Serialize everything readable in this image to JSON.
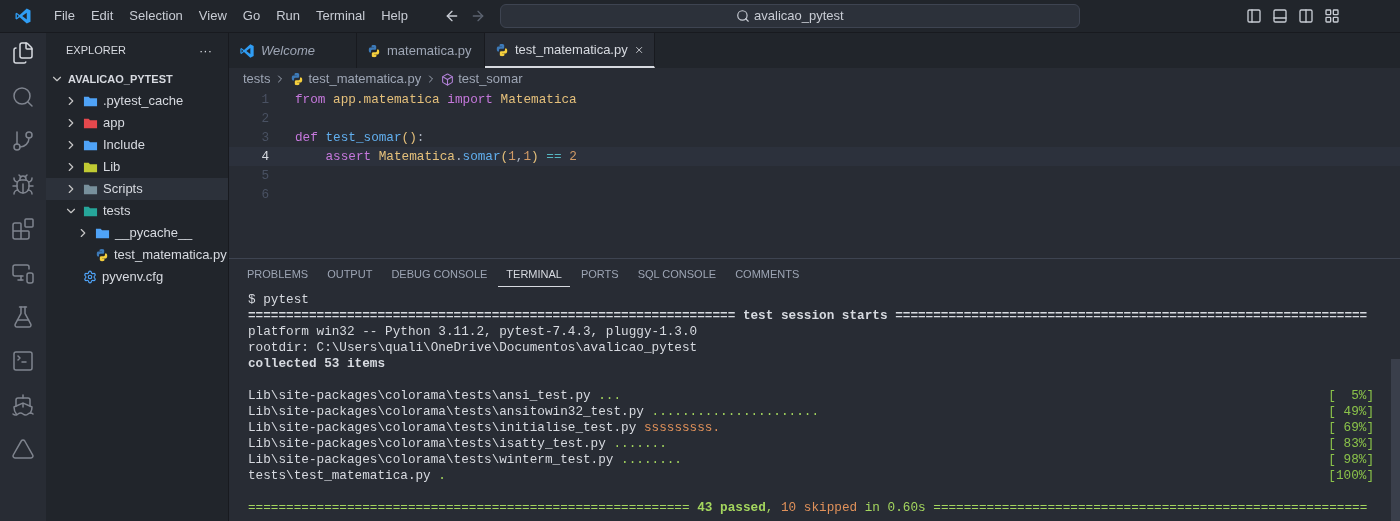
{
  "menu": [
    "File",
    "Edit",
    "Selection",
    "View",
    "Go",
    "Run",
    "Terminal",
    "Help"
  ],
  "command_center": {
    "value": "avalicao_pytest"
  },
  "activity_bar": [
    {
      "kind": "explorer",
      "selected": true
    },
    {
      "kind": "search",
      "selected": false
    },
    {
      "kind": "source-control",
      "selected": false
    },
    {
      "kind": "run-debug",
      "selected": false
    },
    {
      "kind": "extensions",
      "selected": false
    },
    {
      "kind": "remote",
      "selected": false
    },
    {
      "kind": "testing",
      "selected": false
    },
    {
      "kind": "terminal",
      "selected": false
    },
    {
      "kind": "docker",
      "selected": false
    },
    {
      "kind": "atlassian",
      "selected": false
    }
  ],
  "explorer": {
    "title": "EXPLORER",
    "more": "···",
    "root": "AVALICAO_PYTEST",
    "items": [
      {
        "label": ".pytest_cache",
        "kind": "folder",
        "color": "#4fa3f7",
        "expanded": false,
        "selected": false
      },
      {
        "label": "app",
        "kind": "folder",
        "color": "#e5484d",
        "expanded": false,
        "selected": false
      },
      {
        "label": "Include",
        "kind": "folder",
        "color": "#4fa3f7",
        "expanded": false,
        "selected": false
      },
      {
        "label": "Lib",
        "kind": "folder",
        "color": "#c0ca33",
        "expanded": false,
        "selected": false
      },
      {
        "label": "Scripts",
        "kind": "folder",
        "color": "#78909c",
        "expanded": false,
        "selected": true
      },
      {
        "label": "tests",
        "kind": "folder",
        "color": "#26a69a",
        "expanded": true,
        "selected": false,
        "children": [
          {
            "label": "__pycache__",
            "kind": "folder",
            "color": "#4fa3f7",
            "expanded": false,
            "selected": false
          },
          {
            "label": "test_matematica.py",
            "kind": "python",
            "selected": false
          }
        ]
      },
      {
        "label": "pyvenv.cfg",
        "kind": "config",
        "selected": false
      }
    ]
  },
  "tabs": [
    {
      "label": "Welcome",
      "kind": "welcome",
      "preview": true,
      "selected": false
    },
    {
      "label": "matematica.py",
      "kind": "python",
      "preview": false,
      "selected": false
    },
    {
      "label": "test_matematica.py",
      "kind": "python",
      "preview": false,
      "selected": true
    }
  ],
  "breadcrumb": [
    {
      "label": "tests",
      "kind": "folder"
    },
    {
      "label": "test_matematica.py",
      "kind": "python"
    },
    {
      "label": "test_somar",
      "kind": "method"
    }
  ],
  "code": [
    {
      "number": "1",
      "current": false,
      "tokens": [
        {
          "text": "from",
          "kind": "keyword"
        },
        {
          "text": " app.matematica",
          "kind": "class"
        },
        {
          "text": " import",
          "kind": "keyword"
        },
        {
          "text": " Matematica",
          "kind": "class"
        }
      ]
    },
    {
      "number": "2",
      "current": false
    },
    {
      "number": "3",
      "current": false,
      "tokens": [
        {
          "text": "def",
          "kind": "keyword"
        },
        {
          "text": " test_somar",
          "kind": "function"
        },
        {
          "text": "()",
          "kind": "bracket"
        },
        {
          "text": ":",
          "kind": "plain"
        }
      ]
    },
    {
      "number": "4",
      "current": true,
      "tokens": [
        {
          "text": "    assert",
          "kind": "keyword"
        },
        {
          "text": " Matematica",
          "kind": "class"
        },
        {
          "text": ".",
          "kind": "plain"
        },
        {
          "text": "somar",
          "kind": "function"
        },
        {
          "text": "(",
          "kind": "bracket"
        },
        {
          "text": "1",
          "kind": "number"
        },
        {
          "text": ",",
          "kind": "plain"
        },
        {
          "text": "1",
          "kind": "number"
        },
        {
          "text": ")",
          "kind": "bracket"
        },
        {
          "text": " ==",
          "kind": "operator"
        },
        {
          "text": " 2",
          "kind": "number"
        }
      ]
    },
    {
      "number": "5",
      "current": false
    },
    {
      "number": "6",
      "current": false
    }
  ],
  "panel_tabs": [
    {
      "label": "PROBLEMS",
      "selected": false
    },
    {
      "label": "OUTPUT",
      "selected": false
    },
    {
      "label": "DEBUG CONSOLE",
      "selected": false
    },
    {
      "label": "TERMINAL",
      "selected": true
    },
    {
      "label": "PORTS",
      "selected": false
    },
    {
      "label": "SQL CONSOLE",
      "selected": false
    },
    {
      "label": "COMMENTS",
      "selected": false
    }
  ],
  "terminal": {
    "prompt": "$ pytest",
    "header": {
      "left": "================================================================",
      "title": "test session starts",
      "right": "=============================================================="
    },
    "info": [
      "platform win32 -- Python 3.11.2, pytest-7.4.3, pluggy-1.3.0",
      "rootdir: C:\\Users\\quali\\OneDrive\\Documentos\\avalicao_pytest"
    ],
    "collected": "collected 53 items",
    "results": [
      {
        "path": "Lib\\site-packages\\colorama\\tests\\ansi_test.py",
        "marks": "...",
        "kind": "passed",
        "progress": "[  5%]"
      },
      {
        "path": "Lib\\site-packages\\colorama\\tests\\ansitowin32_test.py",
        "marks": "......................",
        "kind": "passed",
        "progress": "[ 49%]"
      },
      {
        "path": "Lib\\site-packages\\colorama\\tests\\initialise_test.py",
        "marks": "sssssssss.",
        "kind": "skipped",
        "progress": "[ 69%]"
      },
      {
        "path": "Lib\\site-packages\\colorama\\tests\\isatty_test.py",
        "marks": ".......",
        "kind": "passed",
        "progress": "[ 83%]"
      },
      {
        "path": "Lib\\site-packages\\colorama\\tests\\winterm_test.py",
        "marks": "........",
        "kind": "passed",
        "progress": "[ 98%]"
      },
      {
        "path": "tests\\test_matematica.py",
        "marks": ".",
        "kind": "passed",
        "progress": "[100%]"
      }
    ],
    "summary": [
      {
        "text": "========================================================== ",
        "kind": "rule"
      },
      {
        "text": "43 passed",
        "kind": "passed"
      },
      {
        "text": ", ",
        "kind": "rule"
      },
      {
        "text": "10 skipped",
        "kind": "skipped"
      },
      {
        "text": " in 0.60s =========================================================",
        "kind": "rule"
      }
    ]
  }
}
